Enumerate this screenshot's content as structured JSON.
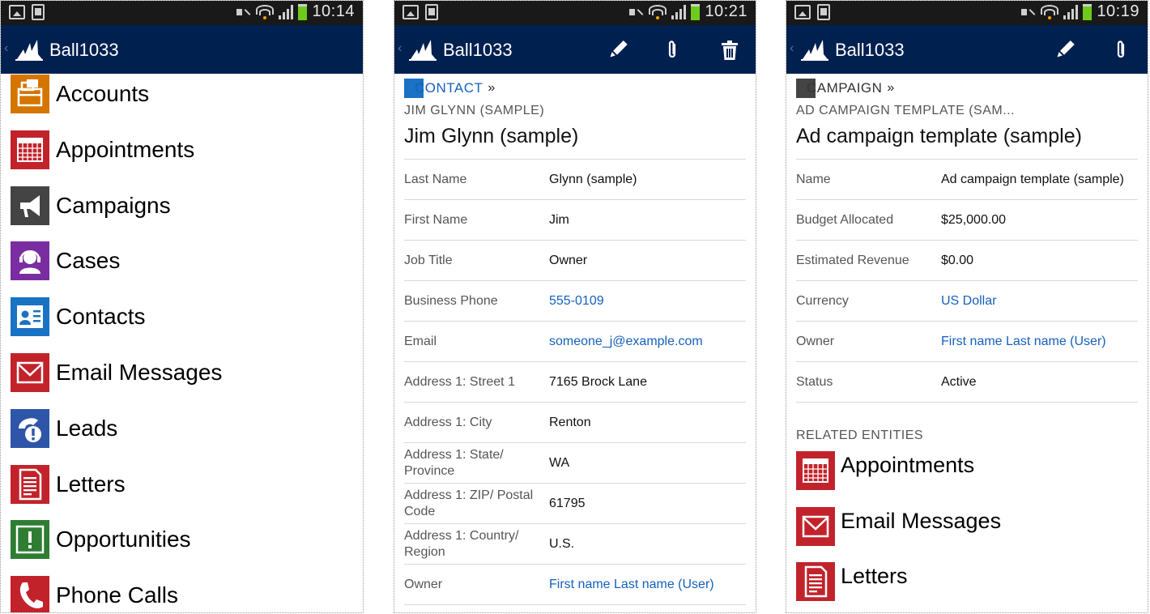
{
  "colors": {
    "app_bar": "#002050",
    "status_bar": "#191919",
    "link": "#1560bd",
    "accounts": "#d47500",
    "appointments": "#c2232b",
    "campaigns": "#444444",
    "cases": "#7a2da0",
    "contacts": "#1a72c4",
    "email": "#c2232b",
    "leads": "#2e55a8",
    "letters": "#c2232b",
    "opportunities": "#2e7d32",
    "phone_calls": "#c2232b"
  },
  "screens": [
    {
      "status_time": "10:14",
      "app_title": "Ball1033",
      "nav_items": [
        {
          "label": "Accounts",
          "icon": "accounts-icon"
        },
        {
          "label": "Appointments",
          "icon": "appointments-icon"
        },
        {
          "label": "Campaigns",
          "icon": "campaigns-icon"
        },
        {
          "label": "Cases",
          "icon": "cases-icon"
        },
        {
          "label": "Contacts",
          "icon": "contacts-icon"
        },
        {
          "label": "Email Messages",
          "icon": "email-messages-icon"
        },
        {
          "label": "Leads",
          "icon": "leads-icon"
        },
        {
          "label": "Letters",
          "icon": "letters-icon"
        },
        {
          "label": "Opportunities",
          "icon": "opportunities-icon"
        },
        {
          "label": "Phone Calls",
          "icon": "phone-calls-icon"
        }
      ]
    },
    {
      "status_time": "10:21",
      "app_title": "Ball1033",
      "actions": [
        "edit-icon",
        "attach-icon",
        "delete-icon"
      ],
      "entity_type": "CONTACT",
      "crumb_separator": "»",
      "record_subtitle": "JIM GLYNN (SAMPLE)",
      "record_title": "Jim Glynn (sample)",
      "fields": [
        {
          "label": "Last Name",
          "value": "Glynn (sample)"
        },
        {
          "label": "First Name",
          "value": "Jim"
        },
        {
          "label": "Job Title",
          "value": "Owner"
        },
        {
          "label": "Business Phone",
          "value": "555-0109"
        },
        {
          "label": "Email",
          "value": "someone_j@example.com"
        },
        {
          "label": "Address 1: Street 1",
          "value": "7165 Brock Lane"
        },
        {
          "label": "Address 1: City",
          "value": "Renton"
        },
        {
          "label": "Address 1: State/ Province",
          "value": "WA"
        },
        {
          "label": "Address 1: ZIP/ Postal Code",
          "value": "61795"
        },
        {
          "label": "Address 1: Country/ Region",
          "value": "U.S."
        },
        {
          "label": "Owner",
          "value": "First name Last name (User)"
        }
      ]
    },
    {
      "status_time": "10:19",
      "app_title": "Ball1033",
      "actions": [
        "edit-icon",
        "attach-icon"
      ],
      "entity_type": "CAMPAIGN",
      "crumb_separator": "»",
      "record_subtitle": "AD CAMPAIGN TEMPLATE (SAM...",
      "record_title": "Ad campaign template (sample)",
      "fields": [
        {
          "label": "Name",
          "value": "Ad campaign template (sample)"
        },
        {
          "label": "Budget Allocated",
          "value": "$25,000.00"
        },
        {
          "label": "Estimated Revenue",
          "value": "$0.00"
        },
        {
          "label": "Currency",
          "value": "US Dollar"
        },
        {
          "label": "Owner",
          "value": "First name Last name (User)"
        },
        {
          "label": "Status",
          "value": "Active"
        }
      ],
      "related_heading": "RELATED ENTITIES",
      "related": [
        {
          "label": "Appointments",
          "icon": "appointments-icon"
        },
        {
          "label": "Email Messages",
          "icon": "email-messages-icon"
        },
        {
          "label": "Letters",
          "icon": "letters-icon"
        }
      ]
    }
  ]
}
